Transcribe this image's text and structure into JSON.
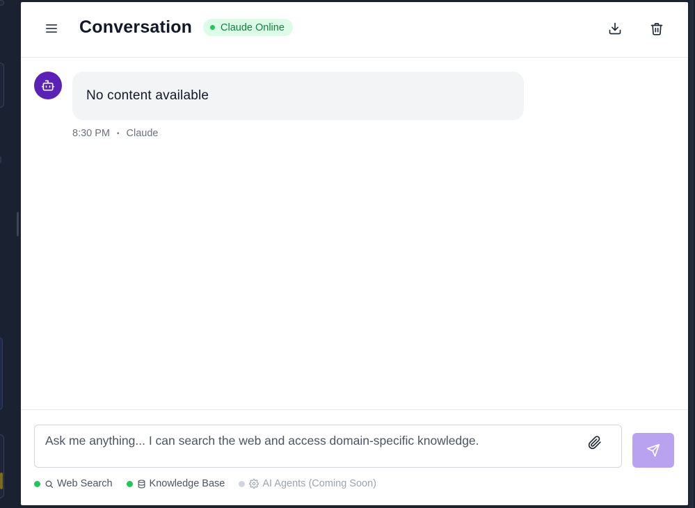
{
  "header": {
    "title": "Conversation",
    "status": "Claude Online",
    "menu_icon": "hamburger-menu-icon",
    "download_icon": "download-icon",
    "delete_icon": "trash-icon"
  },
  "messages": [
    {
      "avatar_icon": "robot-icon",
      "text": "No content available",
      "time": "8:30 PM",
      "separator": "•",
      "author": "Claude"
    }
  ],
  "composer": {
    "placeholder": "Ask me anything... I can search the web and access domain-specific knowledge.",
    "attach_icon": "paperclip-icon",
    "send_icon": "send-icon"
  },
  "tools": [
    {
      "label": "Web Search",
      "icon": "search-icon",
      "status": "active"
    },
    {
      "label": "Knowledge Base",
      "icon": "database-icon",
      "status": "active"
    },
    {
      "label": "AI Agents (Coming Soon)",
      "icon": "gear-icon",
      "status": "disabled"
    }
  ],
  "colors": {
    "accent": "#5b21b6",
    "send_button": "#b9a3f0",
    "online_badge_bg": "#dcfce7",
    "online_badge_text": "#15803d",
    "status_active": "#22c55e",
    "status_inactive": "#d1d5db"
  }
}
